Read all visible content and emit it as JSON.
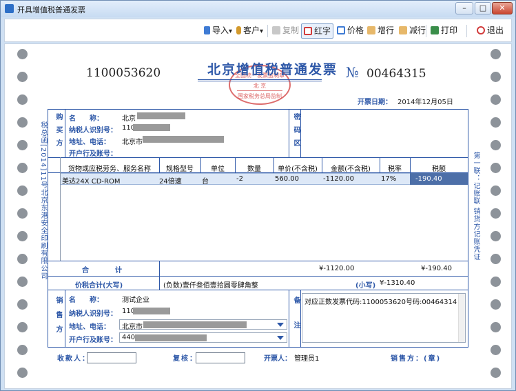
{
  "window": {
    "title": "开具增值税普通发票",
    "controls": {
      "minimize": "–",
      "maximize": "□",
      "close": "✕"
    }
  },
  "toolbar": {
    "import": "导入",
    "customer": "客户",
    "copy": "复制",
    "red": "红字",
    "price": "价格",
    "add_line": "增行",
    "remove_line": "减行",
    "print": "打印",
    "exit": "退出",
    "dropdown_glyph": "▾"
  },
  "invoice": {
    "title": "北京增值税普通发票",
    "code": "1100053620",
    "number_mark": "№",
    "number": "00464315",
    "date_label": "开票日期：",
    "date": "2014年12月05日",
    "seal": {
      "line1": "全国统一发票监制章",
      "line2": "北 京",
      "line3": "国家税务总局监制"
    },
    "left_margin_text": "税总函[2014]11号北京东港安全印刷有限公司",
    "right_margin_text": "第一联：记账联 销货方记账凭证"
  },
  "buyer": {
    "side_label": "购买方",
    "name_label": "名　　称：",
    "name_value": "北京",
    "tax_id_label": "纳税人识别号：",
    "tax_id_value": "110",
    "address_label": "地址、电话：",
    "address_value": "北京市",
    "bank_label": "开户行及账号：",
    "bank_value": ""
  },
  "password_area": {
    "label": "密码区"
  },
  "items_table": {
    "columns": [
      "货物或应税劳务、服务名称",
      "规格型号",
      "单位",
      "数量",
      "单价(不含税)",
      "金额(不含税)",
      "税率",
      "税额"
    ],
    "rows": [
      [
        "美达24X CD-ROM",
        "24倍速",
        "台",
        "-2",
        "560.00",
        "-1120.00",
        "17%",
        "-190.40"
      ]
    ]
  },
  "totals": {
    "label": "合　　　计",
    "amount": "¥-1120.00",
    "tax": "¥-190.40",
    "grand_label": "价税合计(大写)",
    "grand_words": "(负数)壹仟叁佰壹拾圆零肆角整",
    "small_label": "(小写)",
    "grand_small": "¥-1310.40"
  },
  "seller": {
    "side_label": "销售方",
    "name_label": "名　　称：",
    "name_value": "测试企业",
    "tax_id_label": "纳税人识别号：",
    "tax_id_value": "110",
    "address_label": "地址、电话：",
    "address_value": "北京市",
    "bank_label": "开户行及账号：",
    "bank_value": "440"
  },
  "remarks": {
    "label": "备注",
    "text": "对应正数发票代码:1100053620号码:00464314"
  },
  "footer": {
    "payee_label": "收款人：",
    "reviewer_label": "复核：",
    "issuer_label": "开票人：",
    "issuer_value": "管理员1",
    "seller_seal_label": "销售方：(章)"
  },
  "colors": {
    "form_blue": "#2e58a8",
    "seal_red": "#d23c3c",
    "selection": "#4d6fa8"
  }
}
